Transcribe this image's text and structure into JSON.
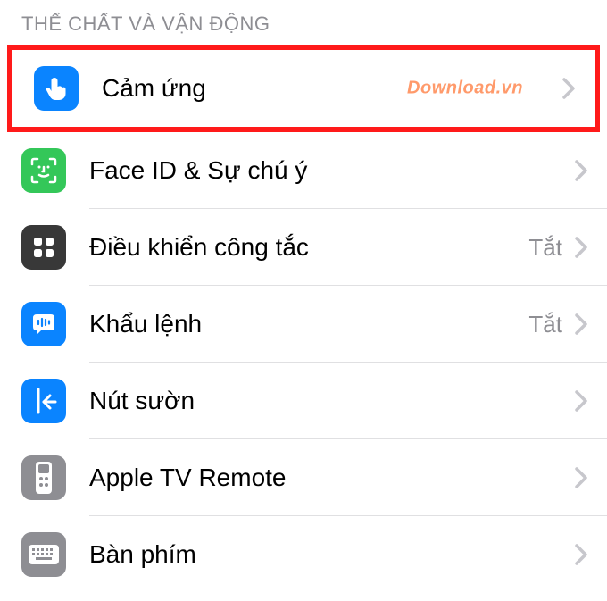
{
  "section": {
    "header": "THỂ CHẤT VÀ VẬN ĐỘNG"
  },
  "rows": {
    "touch": {
      "label": "Cảm ứng"
    },
    "faceid": {
      "label": "Face ID & Sự chú ý"
    },
    "switch": {
      "label": "Điều khiển công tắc",
      "value": "Tắt"
    },
    "voice": {
      "label": "Khẩu lệnh",
      "value": "Tắt"
    },
    "side": {
      "label": "Nút sườn"
    },
    "tvremote": {
      "label": "Apple TV Remote"
    },
    "keyboard": {
      "label": "Bàn phím"
    }
  },
  "watermark": "Download.vn"
}
